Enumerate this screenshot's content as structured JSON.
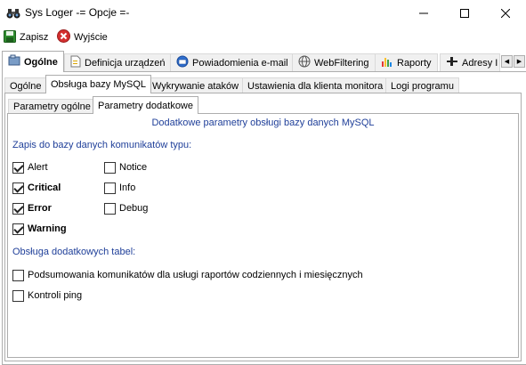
{
  "window": {
    "title": "Sys Loger -= Opcje =-"
  },
  "toolbar": {
    "save_label": "Zapisz",
    "exit_label": "Wyjście"
  },
  "main_tabs": [
    {
      "label": "Ogólne",
      "icon": "settings-icon"
    },
    {
      "label": "Definicja urządzeń",
      "icon": "document-icon"
    },
    {
      "label": "Powiadomienia e-mail",
      "icon": "globe-mail-icon"
    },
    {
      "label": "WebFiltering",
      "icon": "web-icon"
    },
    {
      "label": "Raporty",
      "icon": "chart-icon"
    },
    {
      "label": "Adresy I",
      "icon": "pin-icon"
    }
  ],
  "sub_tabs": [
    {
      "label": "Ogólne"
    },
    {
      "label": "Obsługa bazy MySQL"
    },
    {
      "label": "Wykrywanie ataków"
    },
    {
      "label": "Ustawienia dla klienta monitora"
    },
    {
      "label": "Logi programu"
    }
  ],
  "inner_tabs": [
    {
      "label": "Parametry ogólne"
    },
    {
      "label": "Parametry dodatkowe"
    }
  ],
  "content": {
    "heading": "Dodatkowe parametry obsługi bazy danych MySQL",
    "section1": "Zapis do bazy danych komunikatów typu:",
    "alert": "Alert",
    "notice": "Notice",
    "critical": "Critical",
    "info": "Info",
    "error": "Error",
    "debug": "Debug",
    "warning": "Warning",
    "section2": "Obsługa dodatkowych tabel:",
    "summary_table": "Podsumowania komunikatów dla usługi raportów codziennych i miesięcznych",
    "ping_table": "Kontroli ping"
  },
  "checkbox_states": {
    "alert": true,
    "notice": false,
    "critical": true,
    "info": false,
    "error": true,
    "debug": false,
    "warning": true,
    "summary_table": false,
    "ping_table": false
  },
  "colors": {
    "section_text": "#1f3f99",
    "border": "#adadad",
    "save_icon": "#2e8b2e",
    "exit_icon": "#d32f2f"
  }
}
